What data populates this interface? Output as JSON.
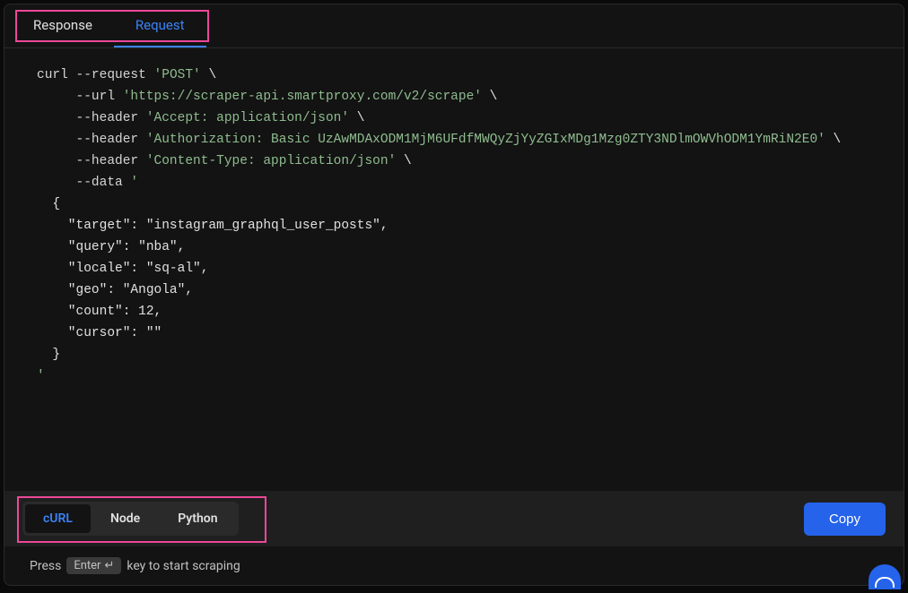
{
  "tabs": {
    "response": "Response",
    "request": "Request"
  },
  "code": {
    "l1_a": "curl ",
    "l1_b": "--request",
    "l1_c": " 'POST'",
    "l1_d": " \\",
    "l2_a": "     --url",
    "l2_b": " 'https://scraper-api.smartproxy.com/v2/scrape'",
    "l2_c": " \\",
    "l3_a": "     --header",
    "l3_b": " 'Accept: application/json'",
    "l3_c": " \\",
    "l4_a": "     --header",
    "l4_b": " 'Authorization: Basic UzAwMDAxODM1MjM6UFdfMWQyZjYyZGIxMDg1Mzg0ZTY3NDlmOWVhODM1YmRiN2E0'",
    "l4_c": " \\",
    "l5_a": "     --header",
    "l5_b": " 'Content-Type: application/json'",
    "l5_c": " \\",
    "l6_a": "     --data",
    "l6_b": " '",
    "l7": "  {",
    "l8": "    \"target\": \"instagram_graphql_user_posts\",",
    "l9": "    \"query\": \"nba\",",
    "l10": "    \"locale\": \"sq-al\",",
    "l11": "    \"geo\": \"Angola\",",
    "l12": "    \"count\": 12,",
    "l13": "    \"cursor\": \"\"",
    "l14": "  }",
    "l15": "'"
  },
  "lang": {
    "curl": "cURL",
    "node": "Node",
    "python": "Python"
  },
  "copy_label": "Copy",
  "hint": {
    "prefix": "Press",
    "key": "Enter",
    "suffix": "key to start scraping"
  }
}
